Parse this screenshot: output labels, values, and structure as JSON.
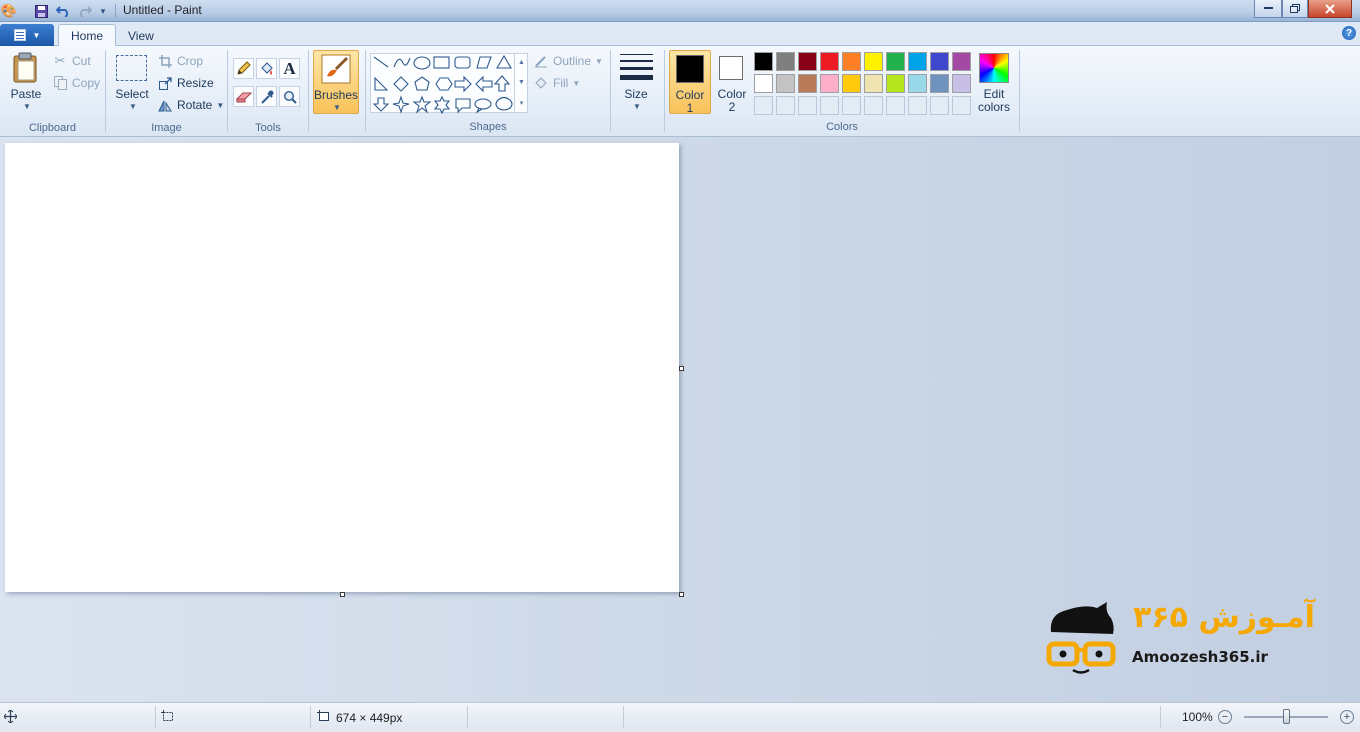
{
  "window": {
    "title": "Untitled - Paint",
    "quick_access": [
      "paint-app-icon",
      "save-icon",
      "undo-icon",
      "redo-icon",
      "customize-dropdown-icon"
    ]
  },
  "tabs": {
    "home": "Home",
    "view": "View"
  },
  "ribbon": {
    "clipboard": {
      "label": "Clipboard",
      "paste": "Paste",
      "cut": "Cut",
      "copy": "Copy"
    },
    "image": {
      "label": "Image",
      "select": "Select",
      "crop": "Crop",
      "resize": "Resize",
      "rotate": "Rotate"
    },
    "tools": {
      "label": "Tools"
    },
    "brushes": {
      "label": "Brushes"
    },
    "shapes": {
      "label": "Shapes",
      "outline": "Outline",
      "fill": "Fill"
    },
    "size": {
      "label": "Size"
    },
    "colors": {
      "label": "Colors",
      "color1": "Color",
      "color1_num": "1",
      "color2": "Color",
      "color2_num": "2",
      "edit": "Edit",
      "edit2": "colors",
      "color1_value": "#000000",
      "color2_value": "#ffffff",
      "palette_row1": [
        "#000000",
        "#7f7f7f",
        "#880015",
        "#ed1c24",
        "#ff7f27",
        "#fff200",
        "#22b14c",
        "#00a2e8",
        "#3f48cc",
        "#a349a4"
      ],
      "palette_row2": [
        "#ffffff",
        "#c3c3c3",
        "#b97a57",
        "#ffaec9",
        "#ffc90e",
        "#efe4b0",
        "#b5e61d",
        "#99d9ea",
        "#7092be",
        "#c8bfe7"
      ]
    }
  },
  "logo": {
    "persian": "آمـوزش ۳۶۵",
    "latin": "Amoozesh365.ir"
  },
  "status": {
    "dimensions": "674 × 449px",
    "zoom": "100%"
  }
}
